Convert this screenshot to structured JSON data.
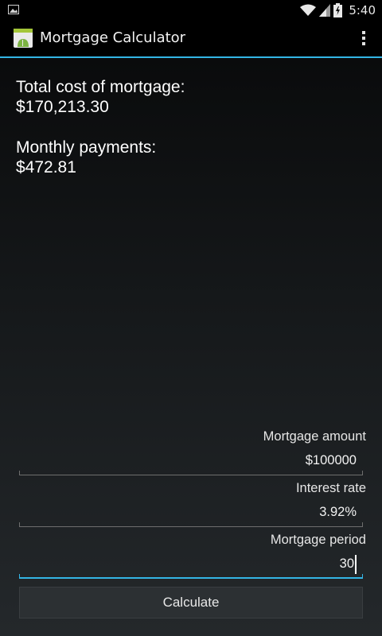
{
  "status_bar": {
    "time": "5:40",
    "icons": [
      "image-notification-icon",
      "wifi-icon",
      "signal-icon",
      "battery-icon"
    ]
  },
  "action_bar": {
    "title": "Mortgage Calculator",
    "icons": [
      "app-icon",
      "overflow-menu-icon"
    ]
  },
  "results": {
    "total_label": "Total cost of mortgage:",
    "total_value": "$170,213.30",
    "monthly_label": "Monthly payments:",
    "monthly_value": "$472.81"
  },
  "form": {
    "amount_label": "Mortgage amount",
    "amount_value": "$100000",
    "rate_label": "Interest rate",
    "rate_value": "3.92%",
    "period_label": "Mortgage period",
    "period_value": "30",
    "calculate_label": "Calculate"
  },
  "colors": {
    "accent": "#33b5e5",
    "background_top": "#0a0b0c",
    "background_bottom": "#24282b",
    "text": "#ffffff"
  }
}
